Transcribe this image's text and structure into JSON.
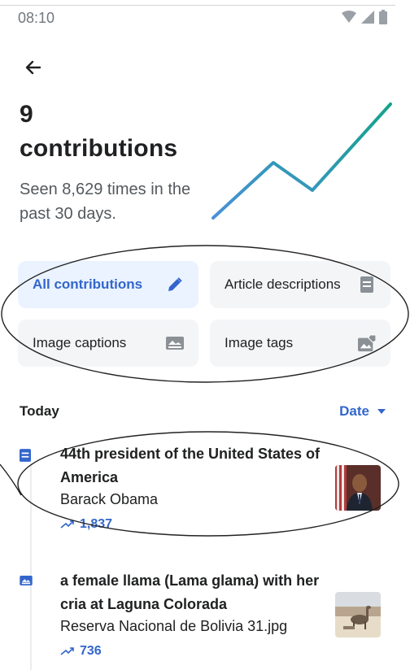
{
  "status_bar": {
    "time": "08:10"
  },
  "header": {
    "count": "9",
    "title": "contributions",
    "seen_text": "Seen 8,629 times in the past 30 days."
  },
  "filters": [
    {
      "label": "All contributions",
      "icon": "pencil-icon",
      "active": true
    },
    {
      "label": "Article descriptions",
      "icon": "description-icon",
      "active": false
    },
    {
      "label": "Image captions",
      "icon": "caption-icon",
      "active": false
    },
    {
      "label": "Image tags",
      "icon": "image-tag-icon",
      "active": false
    }
  ],
  "section": {
    "label": "Today",
    "sort_label": "Date"
  },
  "contributions": [
    {
      "description": "44th president of the United States of America",
      "subject": "Barack Obama",
      "views": "1,837",
      "type_icon": "description-icon"
    },
    {
      "description": "a female llama (Lama glama) with her cria at Laguna Colorada",
      "subject": "Reserva Nacional de Bolivia 31.jpg",
      "views": "736",
      "type_icon": "caption-icon"
    }
  ],
  "colors": {
    "accent": "#3366cc",
    "chip_bg": "#f4f5f7",
    "chip_active_bg": "#eaf3ff",
    "spark_start": "#4a90d9",
    "spark_end": "#14a38b"
  }
}
